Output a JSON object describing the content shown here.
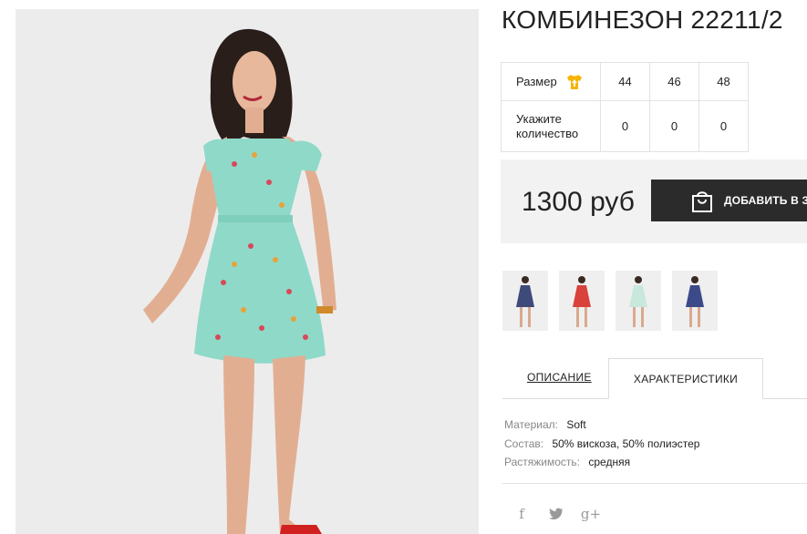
{
  "product": {
    "title": "КОМБИНЕЗОН 22211/2"
  },
  "size_table": {
    "size_label": "Размер",
    "size_icon": "tshirt-arrow-icon",
    "sizes": [
      "44",
      "46",
      "48"
    ],
    "qty_label_line1": "Укажите",
    "qty_label_line2": "количество",
    "quantities": [
      "0",
      "0",
      "0"
    ]
  },
  "purchase": {
    "price": "1300 руб",
    "cart_button_label": "ДОБАВИТЬ В З",
    "cart_icon": "shopping-bag-icon"
  },
  "gallery": {
    "thumbnail_dress_colors": [
      "#3d4a7a",
      "#d8423a",
      "#c8e8dc",
      "#3d4a8a"
    ]
  },
  "tabs": {
    "description": "ОПИСАНИЕ",
    "characteristics": "ХАРАКТЕРИСТИКИ"
  },
  "specs": [
    {
      "key": "Материал:",
      "value": "Soft"
    },
    {
      "key": "Состав:",
      "value": "50% вискоза, 50% полиэстер"
    },
    {
      "key": "Растяжимость:",
      "value": "средняя"
    }
  ],
  "social": {
    "facebook": "f",
    "twitter": "twitter-icon",
    "google_plus": "g+"
  },
  "colors": {
    "accent_yellow": "#f5b400",
    "button_dark": "#2b2b2b",
    "dress_mint": "#8fd9c8"
  }
}
